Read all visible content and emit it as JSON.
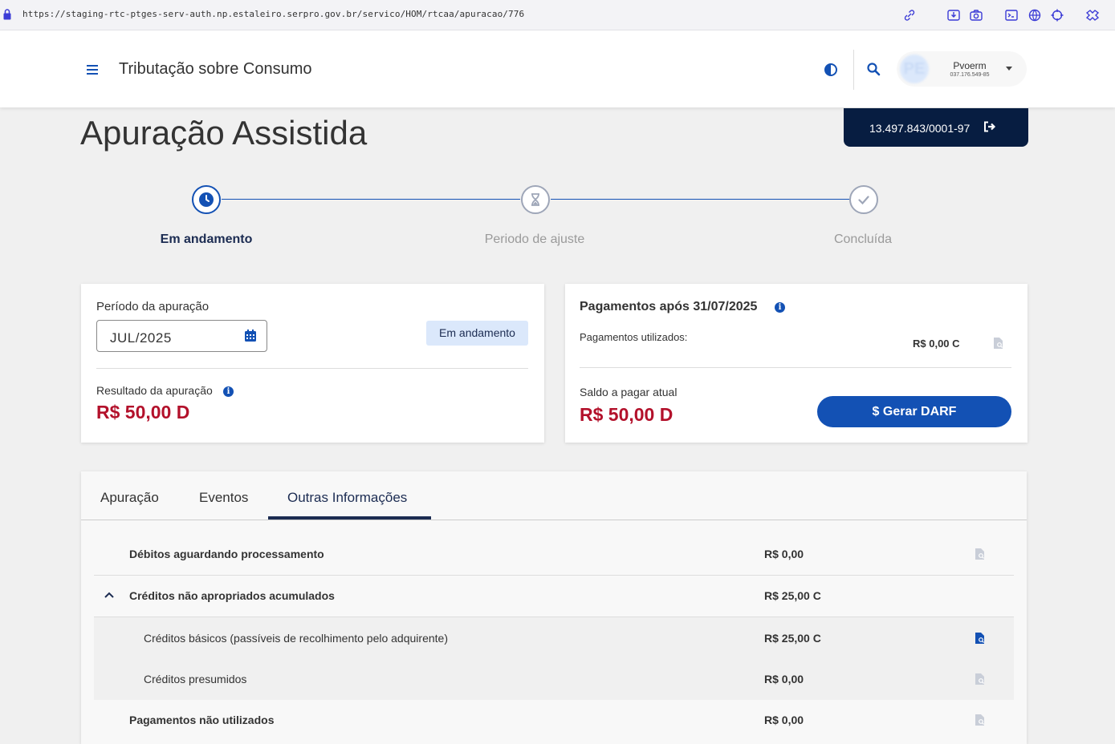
{
  "browser": {
    "url": "https://staging-rtc-ptges-serv-auth.np.estaleiro.serpro.gov.br/servico/HOM/rtcaa/apuracao/776"
  },
  "header": {
    "app_title": "Tributação sobre Consumo",
    "user": {
      "name": "Pvoerm",
      "cpf": "037.176.549-85",
      "avatar_initials": "PE"
    }
  },
  "cnpj": "13.497.843/0001-97",
  "page_title": "Apuração Assistida",
  "stepper": {
    "steps": [
      {
        "label": "Em andamento",
        "state": "current"
      },
      {
        "label": "Periodo de ajuste",
        "state": "pending"
      },
      {
        "label": "Concluída",
        "state": "pending"
      }
    ]
  },
  "periodo_card": {
    "label": "Período da apuração",
    "value": "JUL/2025",
    "status": "Em andamento",
    "resultado_label": "Resultado da apuração",
    "resultado_value": "R$ 50,00 D"
  },
  "pagamentos_card": {
    "title": "Pagamentos após 31/07/2025",
    "utilizados_label": "Pagamentos utilizados:",
    "utilizados_value": "R$ 0,00 C",
    "saldo_label": "Saldo a pagar atual",
    "saldo_value": "R$ 50,00 D",
    "darf_button": "$ Gerar DARF"
  },
  "tabs": [
    {
      "label": "Apuração",
      "active": false
    },
    {
      "label": "Eventos",
      "active": false
    },
    {
      "label": "Outras Informações",
      "active": true
    }
  ],
  "info_rows": [
    {
      "label": "Débitos aguardando processamento",
      "value": "R$ 0,00"
    },
    {
      "label": "Créditos não apropriados acumulados",
      "value": "R$ 25,00 C",
      "expanded": true
    },
    {
      "label": "Créditos básicos (passíveis de recolhimento pelo adquirente)",
      "value": "R$ 25,00 C"
    },
    {
      "label": "Créditos presumidos",
      "value": "R$ 0,00"
    },
    {
      "label": "Pagamentos não utilizados",
      "value": "R$ 0,00"
    }
  ],
  "colors": {
    "primary": "#1351b4",
    "dark_navy": "#071d41",
    "debit_red": "#b3112b",
    "badge_bg": "#dbe8fb"
  },
  "icons": [
    "lock-icon",
    "link-icon",
    "download-icon",
    "camera-icon",
    "terminal-icon",
    "globe-icon",
    "crosshair-icon",
    "extension-icon",
    "menu-icon",
    "contrast-icon",
    "search-icon",
    "logout-icon",
    "clock-icon",
    "hourglass-icon",
    "check-icon",
    "calendar-icon",
    "info-icon",
    "document-search-icon",
    "chevron-up-icon"
  ]
}
